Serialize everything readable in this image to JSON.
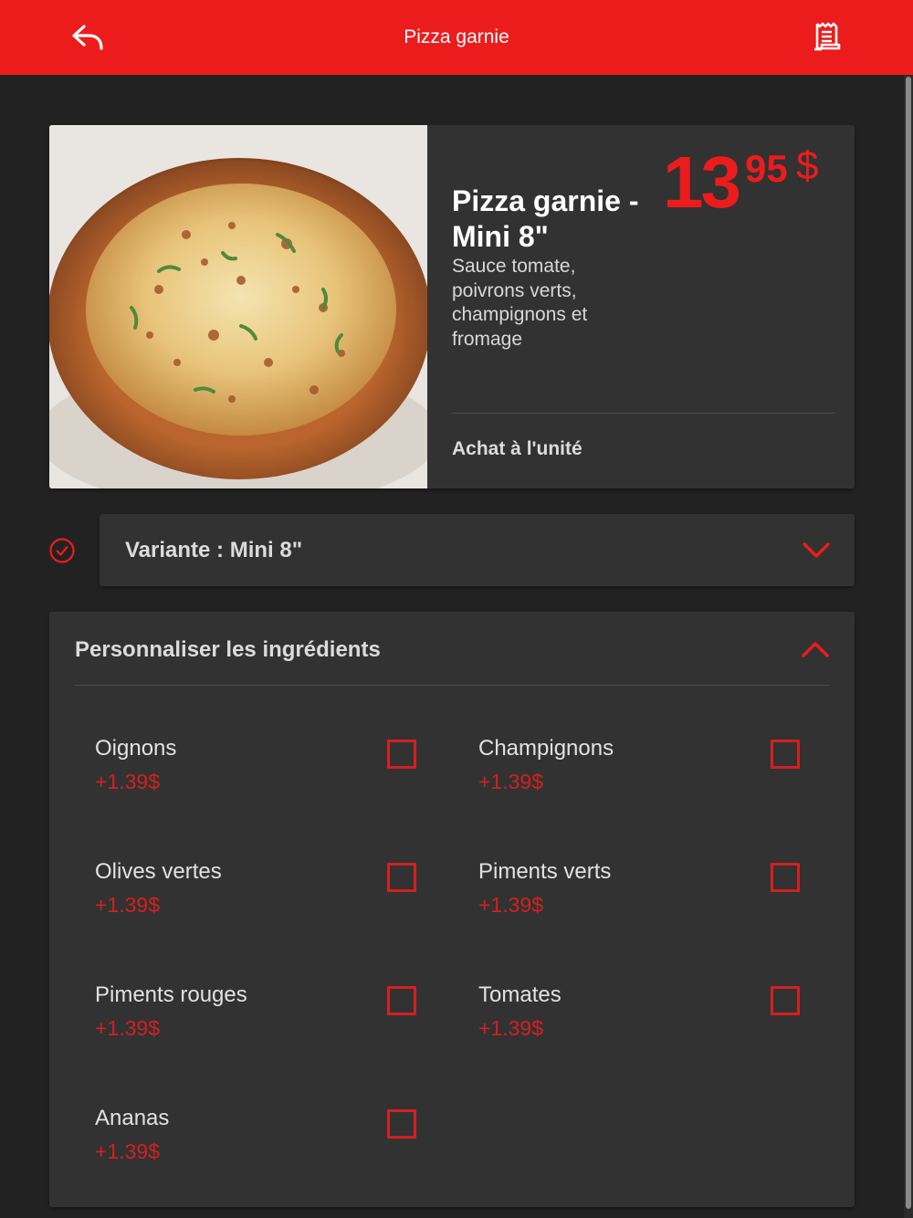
{
  "header": {
    "title": "Pizza garnie"
  },
  "product": {
    "name": "Pizza garnie - Mini 8\"",
    "description": "Sauce tomate, poivrons verts, champignons et fromage",
    "price_integer": "13",
    "price_cents": "95",
    "currency": "$",
    "purchase_mode": "Achat à l'unité"
  },
  "variant": {
    "label": "Variante : Mini 8\""
  },
  "customize": {
    "title": "Personnaliser les ingrédients",
    "ingredients": [
      {
        "name": "Oignons",
        "price": "+1.39$",
        "checked": false
      },
      {
        "name": "Champignons",
        "price": "+1.39$",
        "checked": false
      },
      {
        "name": "Olives vertes",
        "price": "+1.39$",
        "checked": false
      },
      {
        "name": "Piments verts",
        "price": "+1.39$",
        "checked": false
      },
      {
        "name": "Piments rouges",
        "price": "+1.39$",
        "checked": false
      },
      {
        "name": "Tomates",
        "price": "+1.39$",
        "checked": false
      },
      {
        "name": "Ananas",
        "price": "+1.39$",
        "checked": false
      }
    ]
  },
  "colors": {
    "accent": "#ec1c1c",
    "background": "#222222",
    "card": "#323232"
  },
  "icons": {
    "back": "reply-arrow-icon",
    "receipt": "receipt-icon",
    "check": "check-circle-icon",
    "expand": "chevron-down-icon",
    "collapse": "chevron-up-icon"
  }
}
